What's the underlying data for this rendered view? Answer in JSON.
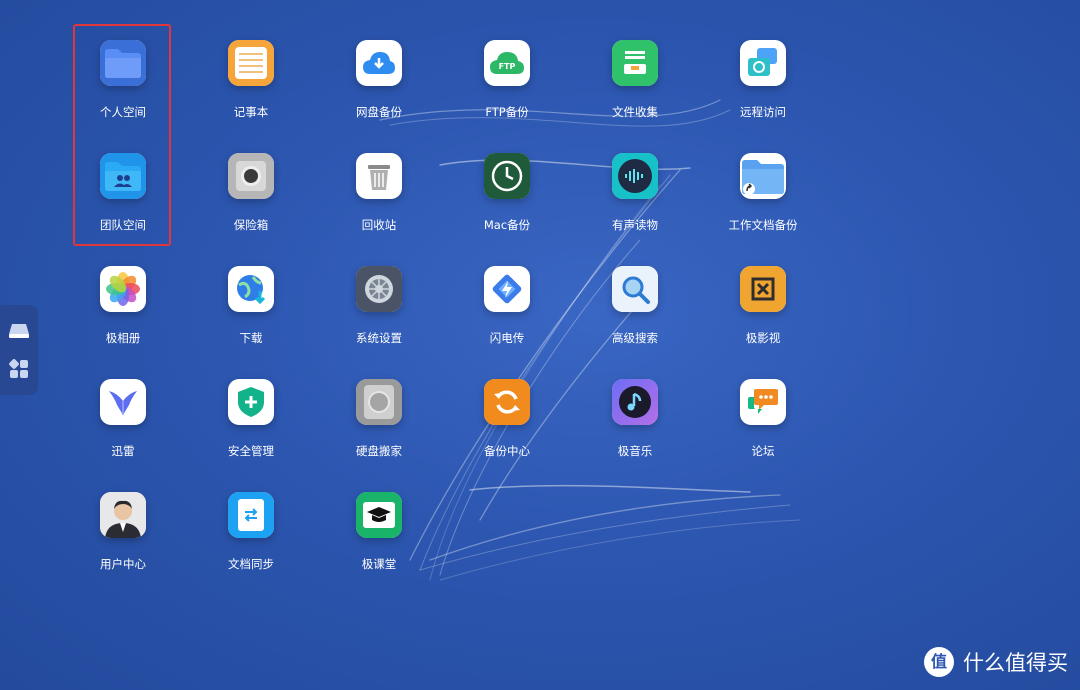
{
  "apps": [
    {
      "label": "个人空间",
      "icon": "folder-icon"
    },
    {
      "label": "记事本",
      "icon": "notepad-icon"
    },
    {
      "label": "网盘备份",
      "icon": "cloud-download-icon"
    },
    {
      "label": "FTP备份",
      "icon": "ftp-cloud-icon"
    },
    {
      "label": "文件收集",
      "icon": "inbox-tray-icon"
    },
    {
      "label": "远程访问",
      "icon": "remote-access-icon"
    },
    {
      "label": "团队空间",
      "icon": "team-folder-icon"
    },
    {
      "label": "保险箱",
      "icon": "safe-icon"
    },
    {
      "label": "回收站",
      "icon": "trash-icon"
    },
    {
      "label": "Mac备份",
      "icon": "time-machine-icon"
    },
    {
      "label": "有声读物",
      "icon": "audio-wave-icon"
    },
    {
      "label": "工作文档备份",
      "icon": "folder-shortcut-icon"
    },
    {
      "label": "极相册",
      "icon": "photos-flower-icon"
    },
    {
      "label": "下载",
      "icon": "globe-download-icon"
    },
    {
      "label": "系统设置",
      "icon": "settings-gear-icon"
    },
    {
      "label": "闪电传",
      "icon": "lightning-transfer-icon"
    },
    {
      "label": "高级搜索",
      "icon": "magnifier-icon"
    },
    {
      "label": "极影视",
      "icon": "video-logo-icon"
    },
    {
      "label": "迅雷",
      "icon": "thunder-bird-icon"
    },
    {
      "label": "安全管理",
      "icon": "shield-plus-icon"
    },
    {
      "label": "硬盘搬家",
      "icon": "hard-disk-icon"
    },
    {
      "label": "备份中心",
      "icon": "sync-arrows-icon"
    },
    {
      "label": "极音乐",
      "icon": "music-note-icon"
    },
    {
      "label": "论坛",
      "icon": "chat-bubble-icon"
    },
    {
      "label": "用户中心",
      "icon": "user-avatar-icon"
    },
    {
      "label": "文档同步",
      "icon": "doc-sync-icon"
    },
    {
      "label": "极课堂",
      "icon": "graduation-cap-icon"
    }
  ],
  "sel_label": "",
  "watermark": {
    "badge": "值",
    "text": "什么值得买"
  },
  "colors": {
    "selection": "#e0363c",
    "background": "#2c56b0"
  }
}
